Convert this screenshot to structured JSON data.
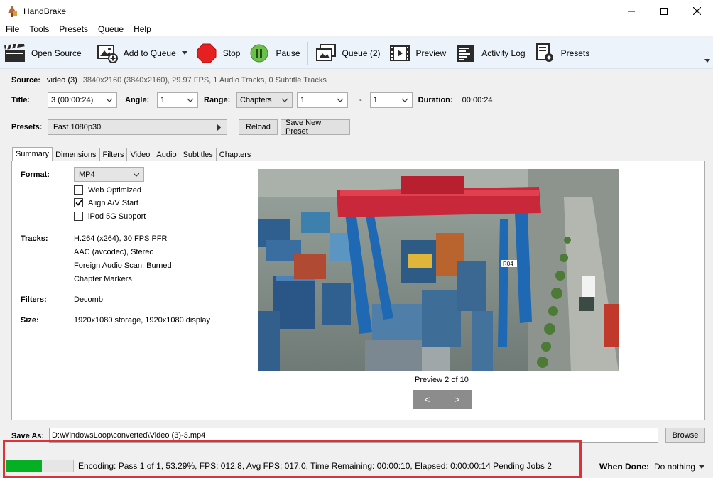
{
  "window": {
    "title": "HandBrake"
  },
  "menu": [
    "File",
    "Tools",
    "Presets",
    "Queue",
    "Help"
  ],
  "toolbar": {
    "open_source": "Open Source",
    "add_to_queue": "Add to Queue",
    "stop": "Stop",
    "pause": "Pause",
    "queue": "Queue (2)",
    "preview": "Preview",
    "activity_log": "Activity Log",
    "presets": "Presets"
  },
  "source": {
    "label": "Source:",
    "name": "video (3)",
    "info": "3840x2160 (3840x2160), 29.97 FPS, 1 Audio Tracks, 0 Subtitle Tracks"
  },
  "title_row": {
    "title_label": "Title:",
    "title_value": "3 (00:00:24)",
    "angle_label": "Angle:",
    "angle_value": "1",
    "range_label": "Range:",
    "range_type": "Chapters",
    "range_start": "1",
    "dash": "-",
    "range_end": "1",
    "duration_label": "Duration:",
    "duration_value": "00:00:24"
  },
  "presets_row": {
    "label": "Presets:",
    "value": "Fast 1080p30",
    "reload": "Reload",
    "save_new": "Save New Preset"
  },
  "tabs": [
    "Summary",
    "Dimensions",
    "Filters",
    "Video",
    "Audio",
    "Subtitles",
    "Chapters"
  ],
  "summary": {
    "format_label": "Format:",
    "format_value": "MP4",
    "options": [
      {
        "label": "Web Optimized",
        "checked": false
      },
      {
        "label": "Align A/V Start",
        "checked": true
      },
      {
        "label": "iPod 5G Support",
        "checked": false
      }
    ],
    "tracks_label": "Tracks:",
    "tracks": [
      "H.264 (x264), 30 FPS PFR",
      "AAC (avcodec), Stereo",
      "Foreign Audio Scan, Burned",
      "Chapter Markers"
    ],
    "filters_label": "Filters:",
    "filters_value": "Decomb",
    "size_label": "Size:",
    "size_value": "1920x1080 storage, 1920x1080 display",
    "preview_caption": "Preview 2 of 10",
    "prev": "<",
    "next": ">",
    "crane_sign": "R04"
  },
  "save": {
    "label": "Save As:",
    "path": "D:\\WindowsLoop\\converted\\Video (3)-3.mp4",
    "browse": "Browse"
  },
  "status": {
    "progress_fraction": 0.5329,
    "text": "Encoding: Pass 1 of 1,  53.29%, FPS: 012.8,  Avg FPS: 017.0,  Time Remaining: 00:00:10,  Elapsed: 0:00:00:14    Pending Jobs 2",
    "when_done_label": "When Done:",
    "when_done_value": "Do nothing"
  },
  "colors": {
    "progress": "#06b025",
    "highlight": "#e0303a",
    "stop": "#e62020",
    "pause": "#6cc04a",
    "toolbar_bg": "#edf3fa"
  }
}
